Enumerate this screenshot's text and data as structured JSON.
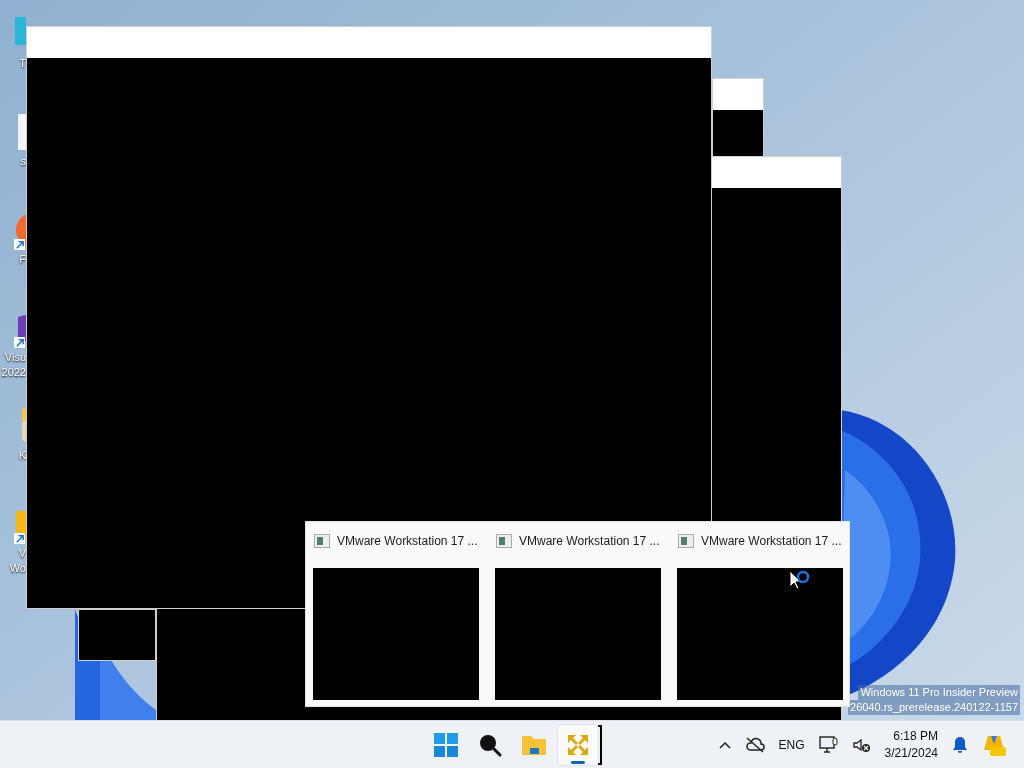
{
  "desktop_icons": [
    {
      "label": "T",
      "kind": "monitor",
      "shortcut": false
    },
    {
      "label": "s",
      "kind": "document",
      "shortcut": false
    },
    {
      "label": "F",
      "kind": "orange-app",
      "shortcut": true
    },
    {
      "label": "Visu\n2022",
      "kind": "purple-app",
      "shortcut": true
    },
    {
      "label": "K",
      "kind": "person",
      "shortcut": false
    },
    {
      "label": "V\nWo",
      "kind": "folder",
      "shortcut": true
    }
  ],
  "watermark": {
    "line_1": "Windows 11 Pro Insider Preview",
    "line_2": "26040.rs_prerelease.240122-1157"
  },
  "preview": {
    "items": [
      {
        "title": "VMware Workstation 17 ..."
      },
      {
        "title": "VMware Workstation 17 ..."
      },
      {
        "title": "VMware Workstation 17 ..."
      }
    ]
  },
  "taskbar": {
    "apps": [
      {
        "kind": "start",
        "active": false
      },
      {
        "kind": "search",
        "active": false
      },
      {
        "kind": "explorer",
        "active": false
      },
      {
        "kind": "vmware",
        "active": true
      }
    ],
    "language": "ENG",
    "time": "6:18 PM",
    "date": "3/21/2024"
  }
}
